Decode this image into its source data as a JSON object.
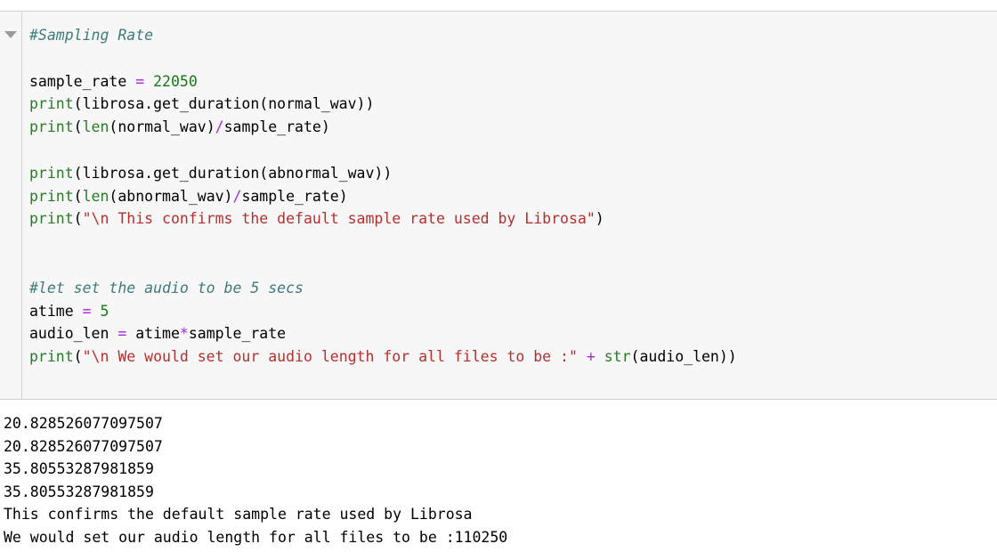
{
  "cell": {
    "collapse_icon": "triangle-down-icon",
    "lines": [
      {
        "id": "line-1",
        "kind": "comment",
        "text": "#Sampling Rate",
        "tokens": [
          {
            "t": "comment",
            "v": "#Sampling Rate"
          }
        ]
      },
      {
        "id": "line-2",
        "kind": "blank",
        "text": "",
        "tokens": [
          {
            "t": "plain",
            "v": " "
          }
        ]
      },
      {
        "id": "line-3",
        "kind": "code",
        "text": "sample_rate = 22050",
        "tokens": [
          {
            "t": "plain",
            "v": "sample_rate "
          },
          {
            "t": "op",
            "v": "="
          },
          {
            "t": "plain",
            "v": " "
          },
          {
            "t": "number",
            "v": "22050"
          }
        ]
      },
      {
        "id": "line-4",
        "kind": "code",
        "text": "print(librosa.get_duration(normal_wav))",
        "tokens": [
          {
            "t": "builtin",
            "v": "print"
          },
          {
            "t": "plain",
            "v": "(librosa.get_duration(normal_wav))"
          }
        ]
      },
      {
        "id": "line-5",
        "kind": "code",
        "text": "print(len(normal_wav)/sample_rate)",
        "tokens": [
          {
            "t": "builtin",
            "v": "print"
          },
          {
            "t": "plain",
            "v": "("
          },
          {
            "t": "builtin",
            "v": "len"
          },
          {
            "t": "plain",
            "v": "(normal_wav)"
          },
          {
            "t": "op",
            "v": "/"
          },
          {
            "t": "plain",
            "v": "sample_rate)"
          }
        ]
      },
      {
        "id": "line-6",
        "kind": "blank",
        "text": "",
        "tokens": [
          {
            "t": "plain",
            "v": " "
          }
        ]
      },
      {
        "id": "line-7",
        "kind": "code",
        "text": "print(librosa.get_duration(abnormal_wav))",
        "tokens": [
          {
            "t": "builtin",
            "v": "print"
          },
          {
            "t": "plain",
            "v": "(librosa.get_duration(abnormal_wav))"
          }
        ]
      },
      {
        "id": "line-8",
        "kind": "code",
        "text": "print(len(abnormal_wav)/sample_rate)",
        "tokens": [
          {
            "t": "builtin",
            "v": "print"
          },
          {
            "t": "plain",
            "v": "("
          },
          {
            "t": "builtin",
            "v": "len"
          },
          {
            "t": "plain",
            "v": "(abnormal_wav)"
          },
          {
            "t": "op",
            "v": "/"
          },
          {
            "t": "plain",
            "v": "sample_rate)"
          }
        ]
      },
      {
        "id": "line-9",
        "kind": "code",
        "text": "print(\"\\n This confirms the default sample rate used by Librosa\")",
        "tokens": [
          {
            "t": "builtin",
            "v": "print"
          },
          {
            "t": "plain",
            "v": "("
          },
          {
            "t": "string",
            "v": "\"\\n This confirms the default sample rate used by Librosa\""
          },
          {
            "t": "plain",
            "v": ")"
          }
        ]
      },
      {
        "id": "line-10",
        "kind": "blank",
        "text": "",
        "tokens": [
          {
            "t": "plain",
            "v": " "
          }
        ]
      },
      {
        "id": "line-11",
        "kind": "blank",
        "text": "",
        "tokens": [
          {
            "t": "plain",
            "v": " "
          }
        ]
      },
      {
        "id": "line-12",
        "kind": "comment",
        "text": "#let set the audio to be 5 secs",
        "tokens": [
          {
            "t": "comment",
            "v": "#let set the audio to be 5 secs"
          }
        ]
      },
      {
        "id": "line-13",
        "kind": "code",
        "text": "atime = 5",
        "tokens": [
          {
            "t": "plain",
            "v": "atime "
          },
          {
            "t": "op",
            "v": "="
          },
          {
            "t": "plain",
            "v": " "
          },
          {
            "t": "number",
            "v": "5"
          }
        ]
      },
      {
        "id": "line-14",
        "kind": "code",
        "text": "audio_len = atime*sample_rate",
        "tokens": [
          {
            "t": "plain",
            "v": "audio_len "
          },
          {
            "t": "op",
            "v": "="
          },
          {
            "t": "plain",
            "v": " atime"
          },
          {
            "t": "op",
            "v": "*"
          },
          {
            "t": "plain",
            "v": "sample_rate"
          }
        ]
      },
      {
        "id": "line-15",
        "kind": "code",
        "text": "print(\"\\n We would set our audio length for all files to be :\" + str(audio_len))",
        "tokens": [
          {
            "t": "builtin",
            "v": "print"
          },
          {
            "t": "plain",
            "v": "("
          },
          {
            "t": "string",
            "v": "\"\\n We would set our audio length for all files to be :\""
          },
          {
            "t": "plain",
            "v": " "
          },
          {
            "t": "op",
            "v": "+"
          },
          {
            "t": "plain",
            "v": " "
          },
          {
            "t": "builtin",
            "v": "str"
          },
          {
            "t": "plain",
            "v": "(audio_len))"
          }
        ]
      }
    ]
  },
  "output": {
    "lines": [
      {
        "id": "out-1",
        "text": "20.828526077097507"
      },
      {
        "id": "out-2",
        "text": "20.828526077097507"
      },
      {
        "id": "out-3",
        "text": "35.80553287981859"
      },
      {
        "id": "out-4",
        "text": "35.80553287981859"
      },
      {
        "id": "out-5",
        "text": "This confirms the default sample rate used by Librosa"
      },
      {
        "id": "out-6",
        "text": "We would set our audio length for all files to be :110250"
      }
    ]
  },
  "colors": {
    "cell_background": "#f7f7f7",
    "output_background": "#ffffff",
    "comment": "#3d7b7b",
    "builtin": "#297a29",
    "number": "#157a15",
    "operator": "#a626e0",
    "string": "#b3302f",
    "plain_text": "#000000",
    "border": "#cfcfcf"
  }
}
